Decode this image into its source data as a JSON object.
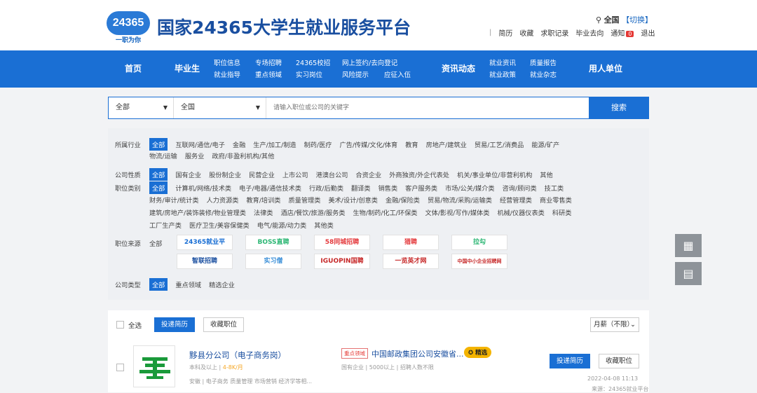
{
  "header": {
    "logo_text": "24365",
    "logo_sub": "一职为你",
    "title": "国家24365大学生就业服务平台",
    "location": "全国",
    "switch_label": "【切换】",
    "user_links": [
      "简历",
      "收藏",
      "求职记录",
      "毕业去向",
      "通知",
      "退出"
    ],
    "notify_count": "0"
  },
  "nav": {
    "home": "首页",
    "grad": "毕业生",
    "grad_links": [
      [
        "职位信息",
        "就业指导"
      ],
      [
        "专场招聘",
        "重点领域"
      ],
      [
        "24365校招",
        "实习岗位"
      ],
      [
        "网上签约/去向登记",
        "风险提示"
      ],
      [
        "",
        "应征入伍"
      ]
    ],
    "news": "资讯动态",
    "news_links": [
      [
        "就业资讯",
        "就业政策"
      ],
      [
        "质量报告",
        "就业杂志"
      ]
    ],
    "employer": "用人单位"
  },
  "search": {
    "category": "全部",
    "region": "全国",
    "placeholder": "请输入职位或公司的关键字",
    "button": "搜索"
  },
  "filters": {
    "industry_label": "所属行业",
    "industry": [
      "全部",
      "互联网/通信/电子",
      "金融",
      "生产/加工/制造",
      "制药/医疗",
      "广告/传媒/文化/体育",
      "教育",
      "房地产/建筑业",
      "贸易/工艺/消费品",
      "能源/矿产"
    ],
    "industry2": [
      "物流/运输",
      "服务业",
      "政府/非盈利机构/其他"
    ],
    "nature_label": "公司性质",
    "nature": [
      "全部",
      "国有企业",
      "股份制企业",
      "民营企业",
      "上市公司",
      "港澳台公司",
      "合资企业",
      "外商独资/外企代表处",
      "机关/事业单位/非营利机构",
      "其他"
    ],
    "jobtype_label": "职位类别",
    "jobtype1": [
      "全部",
      "计算机/网络/技术类",
      "电子/电器/通信技术类",
      "行政/后勤类",
      "翻译类",
      "销售类",
      "客户服务类",
      "市场/公关/媒介类",
      "咨询/顾问类",
      "技工类"
    ],
    "jobtype2": [
      "财务/审计/统计类",
      "人力资源类",
      "教育/培训类",
      "质量管理类",
      "美术/设计/创意类",
      "金融/保险类",
      "贸易/物流/采购/运输类",
      "经营管理类",
      "商业零售类"
    ],
    "jobtype3": [
      "建筑/房地产/装饰装修/物业管理类",
      "法律类",
      "酒店/餐饮/旅游/服务类",
      "生物/制药/化工/环保类",
      "文体/影视/写作/媒体类",
      "机械/仪器仪表类",
      "科研类"
    ],
    "jobtype4": [
      "工厂生产类",
      "医疗卫生/美容保健类",
      "电气/能源/动力类",
      "其他类"
    ],
    "source_label": "职位来源",
    "source_all": "全部",
    "sources": [
      "24365就业平",
      "BOSS直聘",
      "58同城招聘",
      "猎聘",
      "拉勾",
      "智联招聘",
      "实习僧",
      "IGUOPIN国聘",
      "一览英才网",
      "中国中小企业招聘网"
    ],
    "ctype_label": "公司类型",
    "ctype": [
      "全部",
      "重点领域",
      "精选企业"
    ]
  },
  "colors": {
    "primary": "#1a6fd4",
    "title": "#1a4fa0",
    "tag_red": "#e53935",
    "badge_yellow": "#f4b400"
  },
  "side": {
    "qr_icon": "qrcode-icon",
    "chat_icon": "chat-icon"
  },
  "list": {
    "select_all": "全选",
    "deliver_btn": "投递简历",
    "collect_btn": "收藏职位",
    "sort": "月薪（不限）",
    "job": {
      "title": "黟县分公司（电子商务岗）",
      "edu": "本科及以上",
      "salary": "4-8K/月",
      "tags_line": "安徽 | 电子商务  质量管理  市场营销  经济学等相...",
      "tag": "重点领域",
      "company": "中国邮政集团公司安徽省...",
      "featured": "精选",
      "company_meta": "国有企业 | 5000以上 | 招聘人数不限",
      "date": "2022-04-08  11:13",
      "source": "来源：24365就业平台"
    }
  }
}
